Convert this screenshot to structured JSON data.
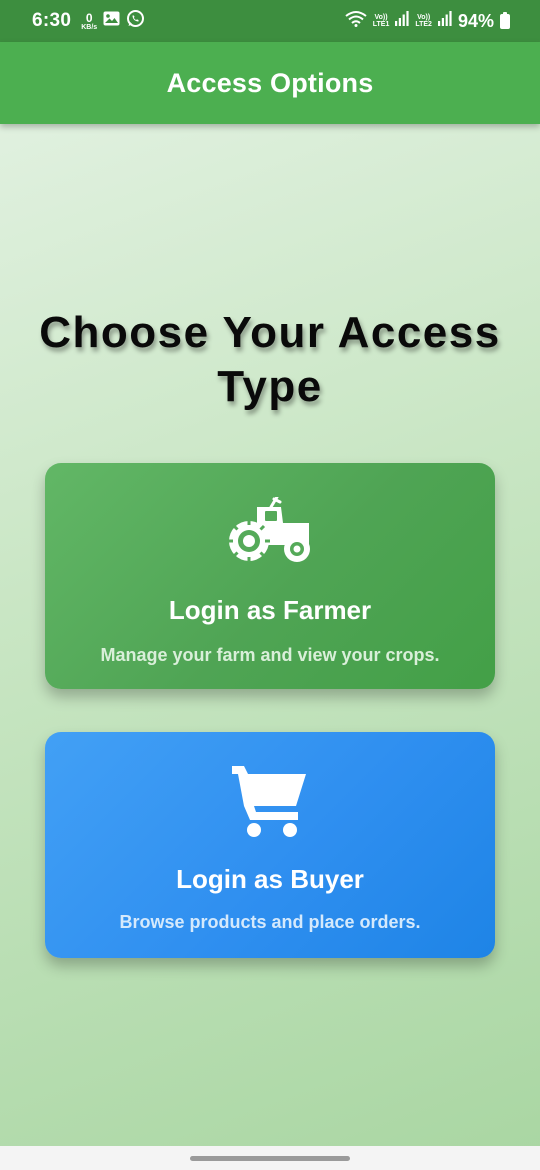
{
  "status_bar": {
    "time": "6:30",
    "net_speed_value": "0",
    "net_speed_unit": "KB/s",
    "sim1_label": "Vo)) LTE1",
    "sim1_top": "Vo))",
    "sim1_bottom": "LTE1",
    "sim2_top": "Vo))",
    "sim2_bottom": "LTE2",
    "battery_percent": "94%",
    "icons": [
      "gallery-icon",
      "whatsapp-icon",
      "wifi-icon",
      "signal-icon",
      "battery-icon"
    ]
  },
  "app_bar": {
    "title": "Access Options",
    "color": "#4caf50"
  },
  "main": {
    "heading": "Choose Your Access Type",
    "options": [
      {
        "title": "Login as Farmer",
        "description": "Manage your farm and view your crops.",
        "icon": "tractor-icon",
        "color": "#4caf50"
      },
      {
        "title": "Login as Buyer",
        "description": "Browse products and place orders.",
        "icon": "shopping-cart-icon",
        "color": "#2f8ff0"
      }
    ]
  }
}
